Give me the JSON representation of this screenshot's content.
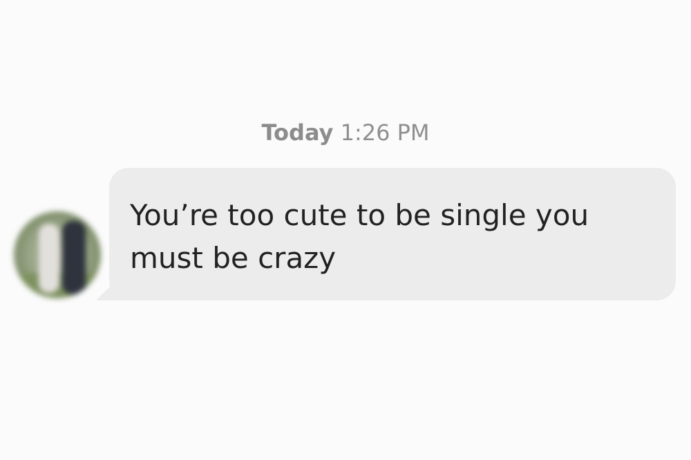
{
  "conversation": {
    "timestamp": {
      "day": "Today",
      "time": "1:26 PM"
    },
    "messages": [
      {
        "sender": "other",
        "text": "You’re too cute to be single you\nmust be crazy"
      }
    ]
  },
  "colors": {
    "background": "#fbfbfb",
    "bubble": "#ececec",
    "message_text": "#222222",
    "timestamp_text": "#8a8a8a"
  }
}
